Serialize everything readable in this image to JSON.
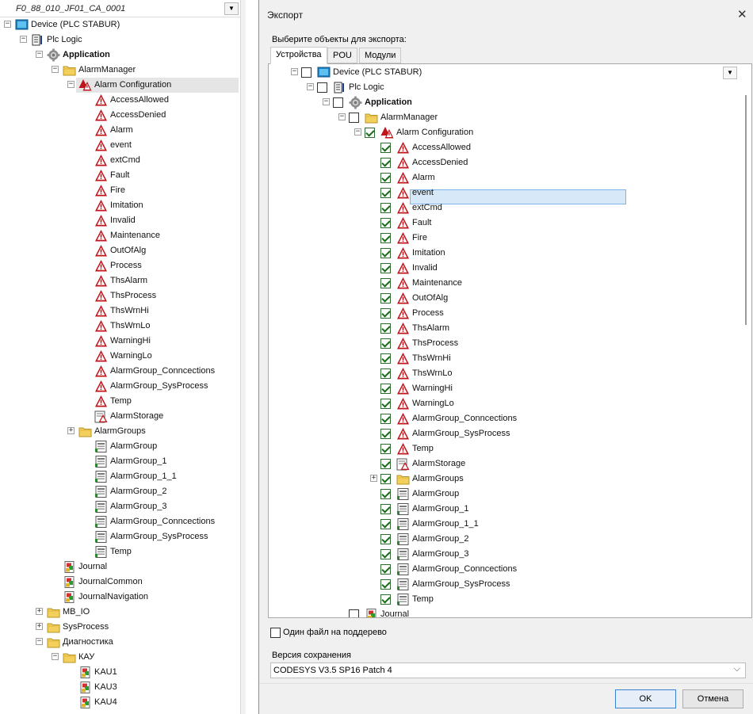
{
  "left_tree": {
    "project": "F0_88_010_JF01_CA_0001",
    "nodes": [
      {
        "label": "Device (PLC STABUR)",
        "icon": "device-icon"
      },
      {
        "label": "Plc Logic",
        "icon": "plc-logic-icon"
      },
      {
        "label": "Application",
        "icon": "application-gear-icon"
      },
      {
        "label": "AlarmManager",
        "icon": "folder-icon"
      },
      {
        "label": "Alarm Configuration",
        "icon": "alarm-configuration-icon"
      },
      {
        "label": "AccessAllowed",
        "icon": "alarm-class-icon"
      },
      {
        "label": "AccessDenied",
        "icon": "alarm-class-icon"
      },
      {
        "label": "Alarm",
        "icon": "alarm-class-icon"
      },
      {
        "label": "event",
        "icon": "alarm-class-icon"
      },
      {
        "label": "extCmd",
        "icon": "alarm-class-icon"
      },
      {
        "label": "Fault",
        "icon": "alarm-class-icon"
      },
      {
        "label": "Fire",
        "icon": "alarm-class-icon"
      },
      {
        "label": "Imitation",
        "icon": "alarm-class-icon"
      },
      {
        "label": "Invalid",
        "icon": "alarm-class-icon"
      },
      {
        "label": "Maintenance",
        "icon": "alarm-class-icon"
      },
      {
        "label": "OutOfAlg",
        "icon": "alarm-class-icon"
      },
      {
        "label": "Process",
        "icon": "alarm-class-icon"
      },
      {
        "label": "ThsAlarm",
        "icon": "alarm-class-icon"
      },
      {
        "label": "ThsProcess",
        "icon": "alarm-class-icon"
      },
      {
        "label": "ThsWrnHi",
        "icon": "alarm-class-icon"
      },
      {
        "label": "ThsWrnLo",
        "icon": "alarm-class-icon"
      },
      {
        "label": "WarningHi",
        "icon": "alarm-class-icon"
      },
      {
        "label": "WarningLo",
        "icon": "alarm-class-icon"
      },
      {
        "label": "AlarmGroup_Conncections",
        "icon": "alarm-class-icon"
      },
      {
        "label": "AlarmGroup_SysProcess",
        "icon": "alarm-class-icon"
      },
      {
        "label": "Temp",
        "icon": "alarm-class-icon"
      },
      {
        "label": "AlarmStorage",
        "icon": "alarm-storage-icon"
      },
      {
        "label": "AlarmGroups",
        "icon": "folder-icon"
      },
      {
        "label": "AlarmGroup",
        "icon": "alarm-group-icon"
      },
      {
        "label": "AlarmGroup_1",
        "icon": "alarm-group-icon"
      },
      {
        "label": "AlarmGroup_1_1",
        "icon": "alarm-group-icon"
      },
      {
        "label": "AlarmGroup_2",
        "icon": "alarm-group-icon"
      },
      {
        "label": "AlarmGroup_3",
        "icon": "alarm-group-icon"
      },
      {
        "label": "AlarmGroup_Conncections",
        "icon": "alarm-group-icon"
      },
      {
        "label": "AlarmGroup_SysProcess",
        "icon": "alarm-group-icon"
      },
      {
        "label": "Temp",
        "icon": "alarm-group-icon"
      },
      {
        "label": "Journal",
        "icon": "journal-icon"
      },
      {
        "label": "JournalCommon",
        "icon": "journal-icon"
      },
      {
        "label": "JournalNavigation",
        "icon": "journal-icon"
      },
      {
        "label": "MB_IO",
        "icon": "folder-icon"
      },
      {
        "label": "SysProcess",
        "icon": "folder-icon"
      },
      {
        "label": "Диагностика",
        "icon": "folder-icon"
      },
      {
        "label": "КАУ",
        "icon": "folder-icon"
      },
      {
        "label": "KAU1",
        "icon": "journal-icon"
      },
      {
        "label": "KAU3",
        "icon": "journal-icon"
      },
      {
        "label": "KAU4",
        "icon": "journal-icon"
      }
    ]
  },
  "dialog": {
    "title": "Экспорт",
    "close": "✕",
    "caption": "Выберите объекты для экспорта:",
    "tabs": [
      "Устройства",
      "POU",
      "Модули"
    ],
    "tree": [
      {
        "label": "Device (PLC STABUR)",
        "checked": false
      },
      {
        "label": "Plc Logic",
        "checked": false
      },
      {
        "label": "Application",
        "checked": false
      },
      {
        "label": "AlarmManager",
        "checked": false
      },
      {
        "label": "Alarm Configuration",
        "checked": true
      },
      {
        "label": "AccessAllowed",
        "checked": true
      },
      {
        "label": "AccessDenied",
        "checked": true
      },
      {
        "label": "Alarm",
        "checked": true
      },
      {
        "label": "event",
        "checked": true
      },
      {
        "label": "extCmd",
        "checked": true
      },
      {
        "label": "Fault",
        "checked": true
      },
      {
        "label": "Fire",
        "checked": true
      },
      {
        "label": "Imitation",
        "checked": true
      },
      {
        "label": "Invalid",
        "checked": true
      },
      {
        "label": "Maintenance",
        "checked": true
      },
      {
        "label": "OutOfAlg",
        "checked": true
      },
      {
        "label": "Process",
        "checked": true
      },
      {
        "label": "ThsAlarm",
        "checked": true
      },
      {
        "label": "ThsProcess",
        "checked": true
      },
      {
        "label": "ThsWrnHi",
        "checked": true
      },
      {
        "label": "ThsWrnLo",
        "checked": true
      },
      {
        "label": "WarningHi",
        "checked": true
      },
      {
        "label": "WarningLo",
        "checked": true
      },
      {
        "label": "AlarmGroup_Conncections",
        "checked": true
      },
      {
        "label": "AlarmGroup_SysProcess",
        "checked": true
      },
      {
        "label": "Temp",
        "checked": true
      },
      {
        "label": "AlarmStorage",
        "checked": true
      },
      {
        "label": "AlarmGroups",
        "checked": true
      },
      {
        "label": "AlarmGroup",
        "checked": true
      },
      {
        "label": "AlarmGroup_1",
        "checked": true
      },
      {
        "label": "AlarmGroup_1_1",
        "checked": true
      },
      {
        "label": "AlarmGroup_2",
        "checked": true
      },
      {
        "label": "AlarmGroup_3",
        "checked": true
      },
      {
        "label": "AlarmGroup_Conncections",
        "checked": true
      },
      {
        "label": "AlarmGroup_SysProcess",
        "checked": true
      },
      {
        "label": "Temp",
        "checked": true
      },
      {
        "label": "Journal",
        "checked": false
      }
    ],
    "single_file_label": "Один файл на поддерево",
    "single_file_checked": false,
    "version_label": "Версия сохранения",
    "version_value": "CODESYS V3.5 SP16 Patch 4",
    "ok": "OK",
    "cancel": "Отмена"
  },
  "colors": {
    "selection_right": "#d7e9f8",
    "selection_left": "#e5e5e5",
    "checkmark": "#1c6b1c",
    "alarm_red": "#c0141b",
    "folder_yellow": "#f3cf5b"
  }
}
